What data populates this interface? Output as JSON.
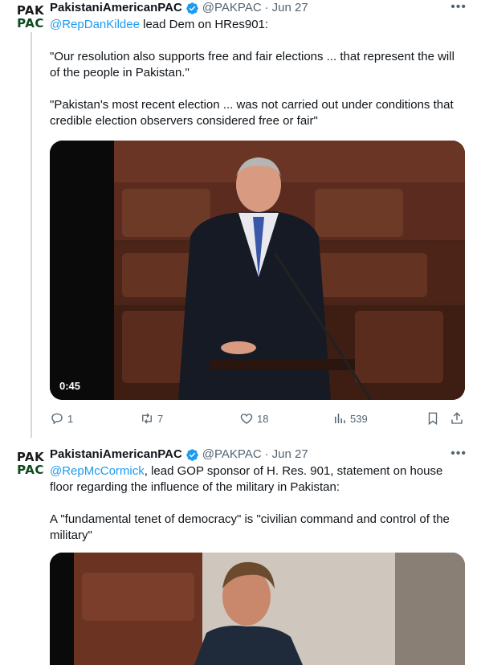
{
  "tweets": [
    {
      "avatar": {
        "line1": "PAK",
        "line2": "PAC"
      },
      "name": "PakistaniAmericanPAC",
      "handle": "@PAKPAC",
      "separator": "·",
      "date": "Jun 27",
      "mention": "@RepDanKildee",
      "line1_rest": " lead Dem on HRes901:",
      "para2": "\"Our resolution also supports free and fair elections ... that represent the will of the people in Pakistan.\"",
      "para3": "\"Pakistan's most recent election ... was not carried out under conditions that credible election observers considered free or fair\"",
      "video_duration": "0:45",
      "stats": {
        "replies": "1",
        "reposts": "7",
        "likes": "18",
        "views": "539"
      }
    },
    {
      "avatar": {
        "line1": "PAK",
        "line2": "PAC"
      },
      "name": "PakistaniAmericanPAC",
      "handle": "@PAKPAC",
      "separator": "·",
      "date": "Jun 27",
      "mention": "@RepMcCormick",
      "line1_rest": ", lead GOP sponsor of H. Res. 901, statement on house floor regarding the influence of the military in Pakistan:",
      "para2": "A \"fundamental tenet of democracy\" is \"civilian command and control of the military\""
    }
  ],
  "icons": {
    "verified": "verified-badge-icon",
    "more": "more-icon",
    "reply": "reply-icon",
    "repost": "repost-icon",
    "like": "like-icon",
    "views": "views-icon",
    "bookmark": "bookmark-icon",
    "share": "share-icon"
  },
  "colors": {
    "link": "#1d9bf0",
    "secondary": "#536471",
    "verified": "#1d9bf0"
  }
}
